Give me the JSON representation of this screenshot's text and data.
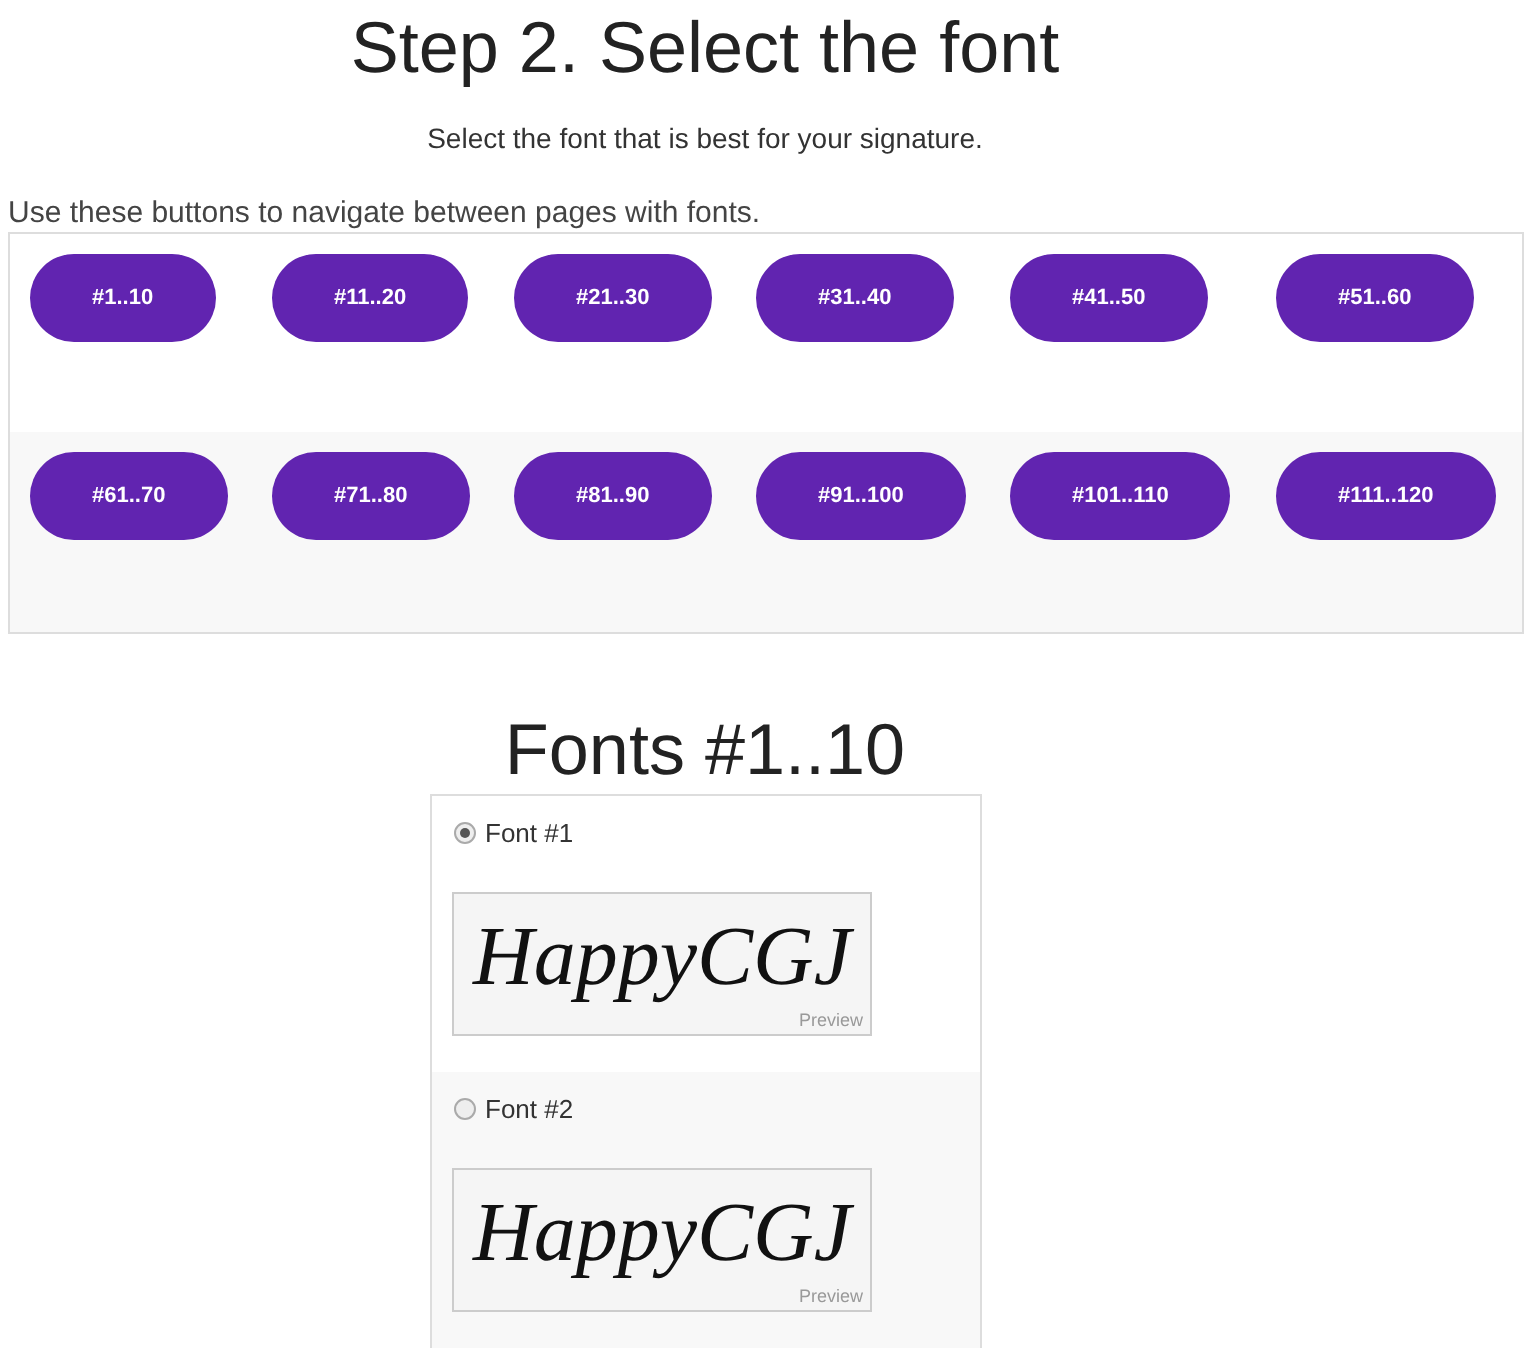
{
  "heading": "Step 2. Select the font",
  "subheading": "Select the font that is best for your signature.",
  "nav_hint": "Use these buttons to navigate between pages with fonts.",
  "page_button_rows": [
    [
      "#1..10",
      "#11..20",
      "#21..30",
      "#31..40",
      "#41..50",
      "#51..60"
    ],
    [
      "#61..70",
      "#71..80",
      "#81..90",
      "#91..100",
      "#101..110",
      "#111..120"
    ]
  ],
  "fonts_heading": "Fonts #1..10",
  "fonts": [
    {
      "label": "Font #1",
      "selected": true,
      "preview_text": "HappyCGJ",
      "preview_label": "Preview"
    },
    {
      "label": "Font #2",
      "selected": false,
      "preview_text": "HappyCGJ",
      "preview_label": "Preview"
    }
  ]
}
